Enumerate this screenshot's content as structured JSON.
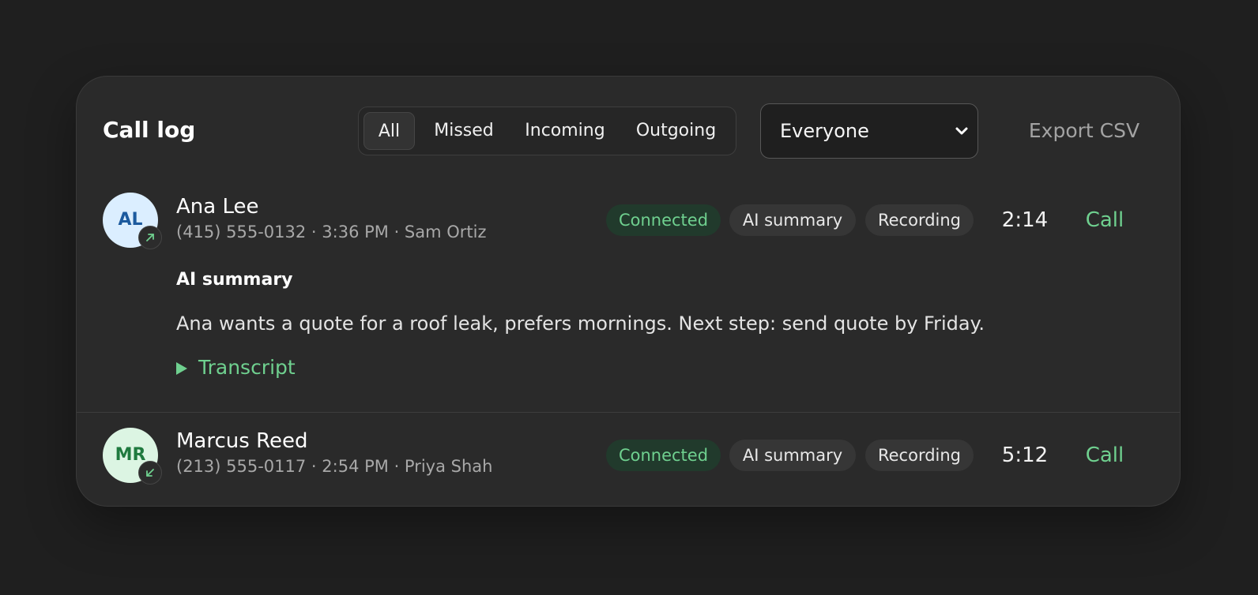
{
  "header": {
    "title": "Call log",
    "filters": [
      {
        "label": "All",
        "active": true
      },
      {
        "label": "Missed",
        "active": false
      },
      {
        "label": "Incoming",
        "active": false
      },
      {
        "label": "Outgoing",
        "active": false
      }
    ],
    "select": {
      "value": "Everyone",
      "icon": "chevron-down-icon"
    },
    "export_label": "Export CSV"
  },
  "colors": {
    "accent": "#6fd08f",
    "background": "#1f1f1f",
    "card": "#2a2a2a"
  },
  "calls": [
    {
      "initials": "AL",
      "avatar_bg": "#dbeeff",
      "avatar_fg": "#1c5a9e",
      "direction": "outgoing",
      "direction_icon": "arrow-up-right-icon",
      "name": "Ana Lee",
      "meta": "(415) 555-0132 · 3:36 PM · Sam Ortiz",
      "status": "Connected",
      "tags": [
        "AI summary",
        "Recording"
      ],
      "duration": "2:14",
      "call_label": "Call",
      "summary_title": "AI summary",
      "summary_text": "Ana wants a quote for a roof leak, prefers mornings. Next step: send quote by Friday.",
      "transcript_label": "Transcript"
    },
    {
      "initials": "MR",
      "avatar_bg": "#dcf5e3",
      "avatar_fg": "#1f7a3f",
      "direction": "incoming",
      "direction_icon": "arrow-down-left-icon",
      "name": "Marcus Reed",
      "meta": "(213) 555-0117 · 2:54 PM · Priya Shah",
      "status": "Connected",
      "tags": [
        "AI summary",
        "Recording"
      ],
      "duration": "5:12",
      "call_label": "Call"
    }
  ]
}
